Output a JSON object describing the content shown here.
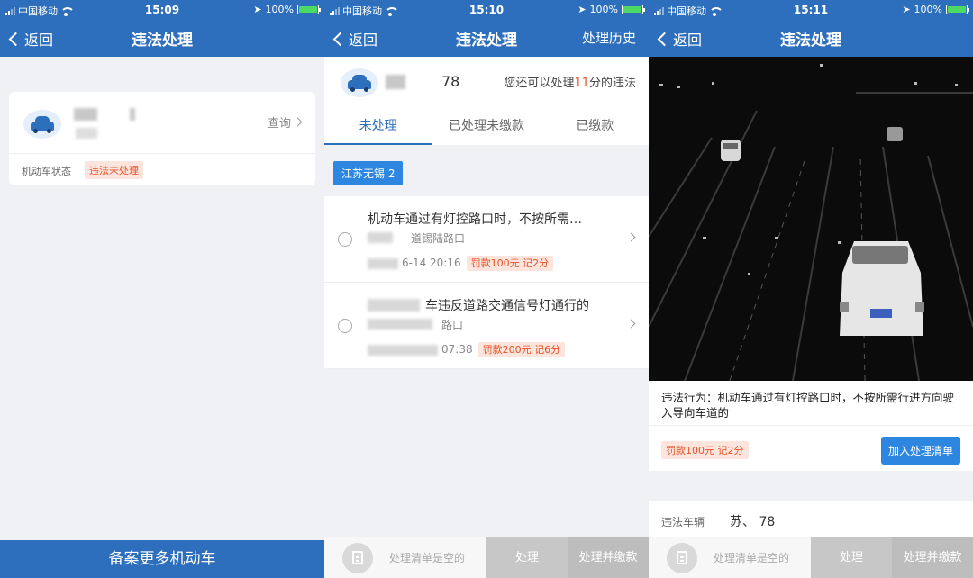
{
  "status_bar": [
    {
      "carrier": "中国移动",
      "time": "15:09",
      "battery": "100%"
    },
    {
      "carrier": "中国移动",
      "time": "15:10",
      "battery": "100%"
    },
    {
      "carrier": "中国移动",
      "time": "15:11",
      "battery": "100%"
    }
  ],
  "screen1": {
    "back": "返回",
    "title": "违法处理",
    "query": "查询",
    "status_label": "机动车状态",
    "status_tag": "违法未处理",
    "register_button": "备案更多机动车"
  },
  "screen2": {
    "back": "返回",
    "title": "违法处理",
    "history": "处理历史",
    "plate_suffix": "78",
    "remaining_prefix": "您还可以处理",
    "remaining_count": "11",
    "remaining_suffix": "分的违法",
    "tabs": [
      "未处理",
      "已处理未缴款",
      "已缴款"
    ],
    "region_tag": "江苏无锡 2",
    "violations": [
      {
        "title": "机动车通过有灯控路口时，不按所需…",
        "location": "道锡陆路口",
        "time": "6-14 20:16",
        "fine": "罚款100元  记2分"
      },
      {
        "title": "车违反道路交通信号灯通行的",
        "location": "路口",
        "time": "07:38",
        "fine": "罚款200元  记6分"
      }
    ],
    "cart_empty": "处理清单是空的",
    "btn_process": "处理",
    "btn_process_pay": "处理并缴款"
  },
  "screen3": {
    "back": "返回",
    "title": "违法处理",
    "description": "违法行为：机动车通过有灯控路口时，不按所需行进方向驶入导向车道的",
    "fine": "罚款100元  记2分",
    "add_button": "加入处理清单",
    "vehicle_label": "违法车辆",
    "vehicle_value": "苏、 78",
    "cart_empty": "处理清单是空的",
    "btn_process": "处理",
    "btn_process_pay": "处理并缴款"
  },
  "colors": {
    "nav": "#2d6fbd",
    "accent": "#2d86e0",
    "warn": "#e6542a"
  }
}
